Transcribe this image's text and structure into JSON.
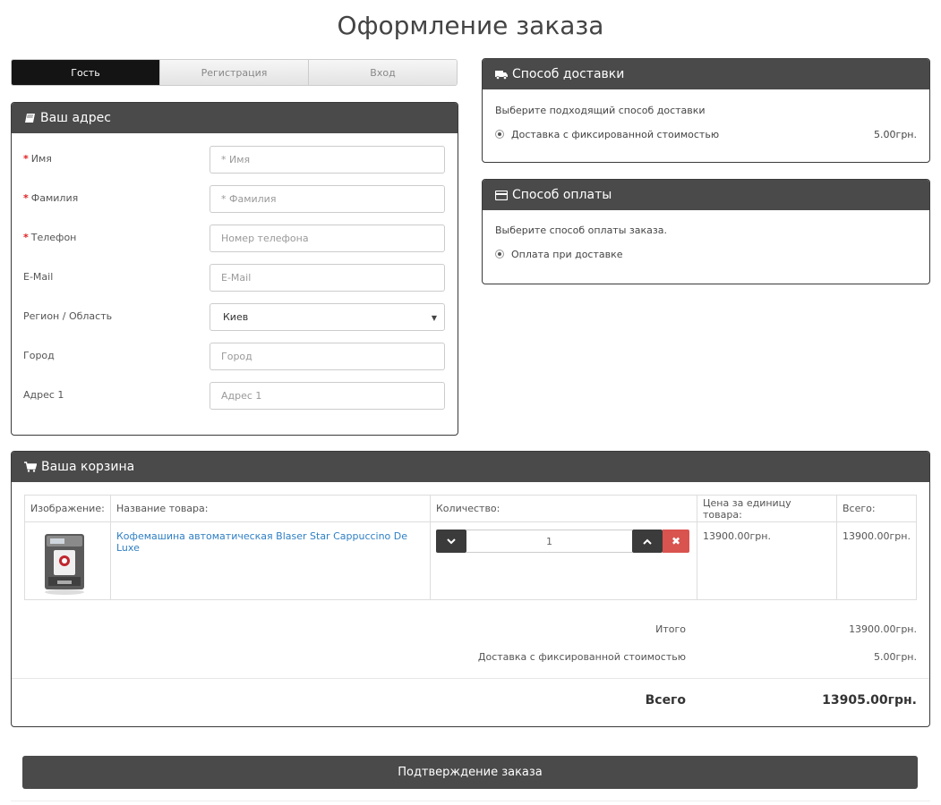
{
  "page": {
    "title": "Оформление заказа"
  },
  "tabs": [
    {
      "label": "Гость",
      "active": true
    },
    {
      "label": "Регистрация",
      "active": false
    },
    {
      "label": "Вход",
      "active": false
    }
  ],
  "address": {
    "heading": "Ваш адрес",
    "fields": [
      {
        "label": "Имя",
        "required": true,
        "placeholder": "* Имя",
        "value": ""
      },
      {
        "label": "Фамилия",
        "required": true,
        "placeholder": "* Фамилия",
        "value": ""
      },
      {
        "label": "Телефон",
        "required": true,
        "placeholder": "Номер телефона",
        "value": ""
      },
      {
        "label": "E-Mail",
        "required": false,
        "placeholder": "E-Mail",
        "value": ""
      },
      {
        "label": "Регион / Область",
        "required": false,
        "type": "select",
        "value": "Киев"
      },
      {
        "label": "Город",
        "required": false,
        "placeholder": "Город",
        "value": ""
      },
      {
        "label": "Адрес 1",
        "required": false,
        "placeholder": "Адрес 1",
        "value": ""
      }
    ]
  },
  "delivery": {
    "heading": "Способ доставки",
    "prompt": "Выберите подходящий способ доставки",
    "option": {
      "label": "Доставка с фиксированной стоимостью",
      "price": "5.00грн.",
      "selected": true
    }
  },
  "payment": {
    "heading": "Способ оплаты",
    "prompt": "Выберите способ оплаты заказа.",
    "option": {
      "label": "Оплата при доставке",
      "selected": true
    }
  },
  "cart": {
    "heading": "Ваша корзина",
    "columns": [
      "Изображение:",
      "Название товара:",
      "Количество:",
      "Цена за единицу товара:",
      "Всего:"
    ],
    "items": [
      {
        "name": "Кофемашина автоматическая Blaser Star Cappuccino De Luxe",
        "quantity": "1",
        "unit_price": "13900.00грн.",
        "total": "13900.00грн."
      }
    ],
    "totals": [
      {
        "label": "Итого",
        "value": "13900.00грн."
      },
      {
        "label": "Доставка с фиксированной стоимостью",
        "value": "5.00грн."
      }
    ],
    "grand_total": {
      "label": "Всего",
      "value": "13905.00грн."
    }
  },
  "confirm": {
    "label": "Подтверждение заказа"
  },
  "icons": {
    "address": "book-icon",
    "delivery": "truck-icon",
    "payment": "credit-card-icon",
    "cart": "shopping-cart-icon",
    "qty_down": "chevron-down-icon",
    "qty_up": "chevron-up-icon",
    "remove": "close-icon"
  },
  "colors": {
    "header": "#4a4a4a",
    "active_tab": "#141414",
    "link": "#2f7fc4",
    "danger": "#d9534f"
  }
}
